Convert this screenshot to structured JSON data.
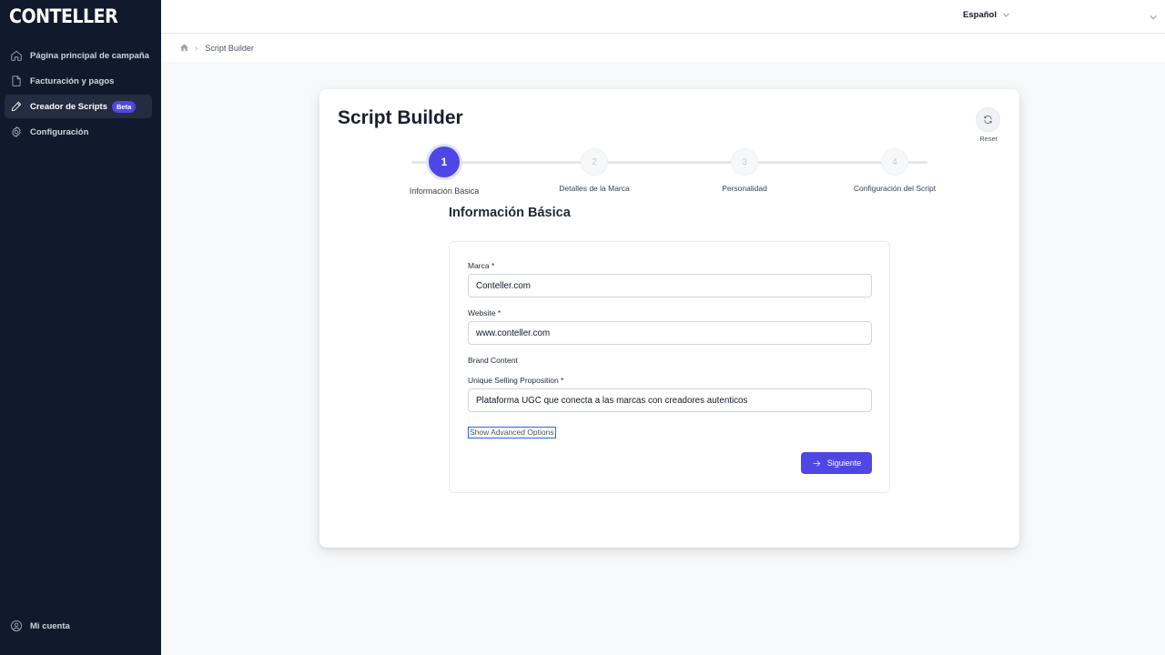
{
  "sidebar": {
    "logo": "CONTELLER",
    "items": [
      {
        "label": "Página principal de campaña",
        "icon": "home-icon"
      },
      {
        "label": "Facturación y pagos",
        "icon": "document-icon"
      },
      {
        "label": "Creador de Scripts",
        "icon": "pencil-icon",
        "badge": "Beta",
        "active": true
      },
      {
        "label": "Configuración",
        "icon": "gear-icon"
      }
    ],
    "account": {
      "label": "Mi cuenta",
      "icon": "user-circle-icon"
    }
  },
  "topbar": {
    "language": "Español"
  },
  "breadcrumb": {
    "home_icon": "home-icon",
    "current": "Script Builder"
  },
  "card": {
    "title": "Script Builder",
    "reset_label": "Reset",
    "steps": [
      {
        "number": "1",
        "label": "Información Básica",
        "state": "active"
      },
      {
        "number": "2",
        "label": "Detalles de la Marca",
        "state": "todo"
      },
      {
        "number": "3",
        "label": "Personalidad",
        "state": "todo"
      },
      {
        "number": "4",
        "label": "Configuración del Script",
        "state": "todo"
      }
    ],
    "section_title": "Información Básica",
    "form": {
      "marca": {
        "label": "Marca *",
        "value": "Conteller.com"
      },
      "website": {
        "label": "Website *",
        "value": "www.conteller.com"
      },
      "brand_content_heading": "Brand Content",
      "usp": {
        "label": "Unique Selling Proposition *",
        "value": "Plataforma UGC que conecta a las marcas con creadores autenticos"
      },
      "advanced_link": "Show Advanced Options",
      "next_button": "Siguiente"
    }
  },
  "colors": {
    "sidebar_bg": "#111a2c",
    "accent": "#4f46e5",
    "page_bg": "#f8f9fb"
  }
}
